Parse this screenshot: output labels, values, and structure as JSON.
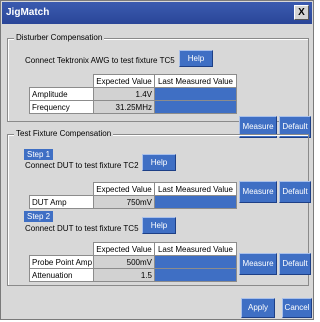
{
  "window": {
    "title": "JigMatch",
    "close_label": "X"
  },
  "disturber": {
    "group_title": "Disturber Compensation",
    "instruction": "Connect Tektronix AWG to test fixture TC5",
    "help_label": "Help",
    "columns": [
      "",
      "Expected Value",
      "Last Measured Value"
    ],
    "rows": [
      {
        "name": "Amplitude",
        "expected": "1.4V",
        "measured": ""
      },
      {
        "name": "Frequency",
        "expected": "31.25MHz",
        "measured": ""
      }
    ],
    "measure_label": "Measure",
    "default_label": "Default"
  },
  "fixture": {
    "group_title": "Test Fixture Compensation",
    "step1": {
      "label": "Step 1",
      "instruction": "Connect DUT to test fixture TC2",
      "help_label": "Help",
      "columns": [
        "",
        "Expected Value",
        "Last Measured Value"
      ],
      "rows": [
        {
          "name": "DUT Amp",
          "expected": "750mV",
          "measured": ""
        }
      ],
      "measure_label": "Measure",
      "default_label": "Default"
    },
    "step2": {
      "label": "Step 2",
      "instruction": "Connect DUT to test fixture TC5",
      "help_label": "Help",
      "columns": [
        "",
        "Expected Value",
        "Last Measured Value"
      ],
      "rows": [
        {
          "name": "Probe Point Amp",
          "expected": "500mV",
          "measured": ""
        },
        {
          "name": "Attenuation",
          "expected": "1.5",
          "measured": ""
        }
      ],
      "measure_label": "Measure",
      "default_label": "Default"
    }
  },
  "footer": {
    "apply_label": "Apply",
    "cancel_label": "Cancel"
  },
  "colors": {
    "titlebar": "#2a4698",
    "accent": "#3f6fc4",
    "dialog_bg": "#d8d8d8"
  }
}
